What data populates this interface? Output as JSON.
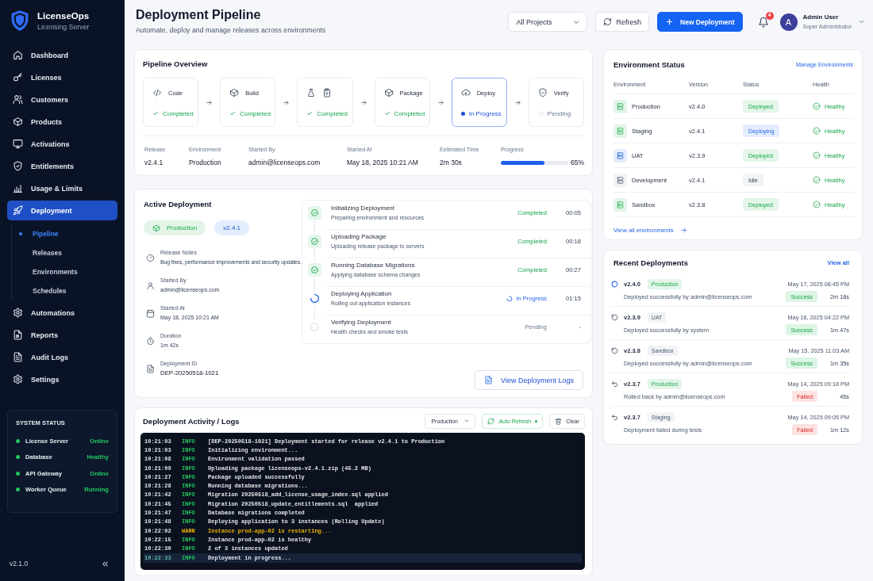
{
  "sidebar": {
    "brand": "LicenseOps",
    "tagline": "Licensing Server",
    "nav": [
      {
        "label": "Dashboard",
        "selected": false
      },
      {
        "label": "Licenses",
        "selected": false
      },
      {
        "label": "Customers",
        "selected": false
      },
      {
        "label": "Products",
        "selected": false
      },
      {
        "label": "Activations",
        "selected": false
      },
      {
        "label": "Entitlements",
        "selected": false
      },
      {
        "label": "Usage & Limits",
        "selected": false
      },
      {
        "label": "Deployment",
        "selected": true,
        "children": [
          {
            "label": "Pipeline",
            "selected": true
          },
          {
            "label": "Releases",
            "selected": false
          },
          {
            "label": "Environments",
            "selected": false
          },
          {
            "label": "Schedules",
            "selected": false
          }
        ]
      },
      {
        "label": "Automations",
        "selected": false
      },
      {
        "label": "Reports",
        "selected": false
      },
      {
        "label": "Audit Logs",
        "selected": false
      },
      {
        "label": "Settings",
        "selected": false
      }
    ],
    "system_status": {
      "title": "SYSTEM STATUS",
      "items": [
        {
          "name": "License Server",
          "status": "Online",
          "color": "#22c55e"
        },
        {
          "name": "Database",
          "status": "Healthy",
          "color": "#22c55e"
        },
        {
          "name": "API Gateway",
          "status": "Online",
          "color": "#22c55e"
        },
        {
          "name": "Worker Queue",
          "status": "Running",
          "color": "#22c55e"
        }
      ]
    },
    "version": "v2.1.0"
  },
  "header": {
    "title": "Deployment Pipeline",
    "subtitle": "Automate, deploy and manage releases across environments",
    "project_filter": "All Projects",
    "refresh_button": "Refresh",
    "new_button": "New Deployment",
    "notification_count": "4",
    "user": {
      "initial": "A",
      "name": "Admin User",
      "role": "Super Administrator"
    }
  },
  "pipeline": {
    "title": "Pipeline Overview",
    "stages": [
      {
        "label": "Code",
        "status": "Completed",
        "kind": "completed"
      },
      {
        "label": "Build",
        "status": "Completed",
        "kind": "completed"
      },
      {
        "status": "Completed",
        "kind": "completed"
      },
      {
        "label": "Package",
        "status": "Completed",
        "kind": "completed"
      },
      {
        "label": "Deploy",
        "status": "In Progress",
        "kind": "running"
      },
      {
        "label": "Verify",
        "status": "Pending",
        "kind": "pending"
      }
    ],
    "details": [
      {
        "label": "Release",
        "value": "v2.4.1"
      },
      {
        "label": "Environment",
        "value": "Production"
      },
      {
        "label": "Started By",
        "value": "admin@licenseops.com"
      },
      {
        "label": "Started At",
        "value": "May 18, 2025 10:21 AM"
      },
      {
        "label": "Estimated Time",
        "value": "2m 30s"
      }
    ],
    "progress": {
      "label": "Progress",
      "level": 0.65,
      "reading": "65%"
    }
  },
  "active_deployment": {
    "title": "Active Deployment",
    "tags": [
      {
        "label": "Production",
        "color": "#e3f5e9"
      },
      {
        "label": "v2.4.1",
        "color": "#e4edfd"
      }
    ],
    "details": [
      {
        "label": "Release Notes",
        "value": "Bug fixes, performance improvements and security updates."
      },
      {
        "label": "Started By",
        "value": "admin@licenseops.com"
      },
      {
        "label": "Started At",
        "value": "May 18, 2025 10:21 AM"
      },
      {
        "label": "Duration",
        "value": "1m 42s"
      },
      {
        "label": "Deployment ID",
        "value": "DEP-20250518-1021"
      }
    ],
    "steps": [
      {
        "title": "Initializing Deployment",
        "description": "Preparing environment and resources",
        "status": "Completed",
        "kind": "completed",
        "time": "00:05"
      },
      {
        "title": "Uploading Package",
        "description": "Uploading release package to servers",
        "status": "Completed",
        "kind": "completed",
        "time": "00:18"
      },
      {
        "title": "Running Database Migrations",
        "description": "Applying database schema changes",
        "status": "Completed",
        "kind": "completed",
        "time": "00:27"
      },
      {
        "title": "Deploying Application",
        "description": "Rolling out application instances",
        "status": "In Progress",
        "kind": "running",
        "time": "01:15"
      },
      {
        "title": "Verifying Deployment",
        "description": "Health checks and smoke tests",
        "status": "Pending",
        "kind": "pending",
        "time": "-"
      }
    ],
    "logs_button": "View Deployment Logs"
  },
  "logs": {
    "title": "Deployment Activity / Logs",
    "environment_filter": "Production",
    "auto_refresh": {
      "label": "Auto Refresh",
      "on": true
    },
    "clear_button": "Clear",
    "lines": [
      {
        "time": "10:21:03",
        "severity": "INFO",
        "kind": "info",
        "message": "[DEP-20250518-1021] Deployment started for release v2.4.1 to Production",
        "selected": false
      },
      {
        "time": "10:21:03",
        "severity": "INFO",
        "kind": "info",
        "message": "Initializing environment...",
        "selected": false
      },
      {
        "time": "10:21:08",
        "severity": "INFO",
        "kind": "info",
        "message": "Environment validation passed",
        "selected": false
      },
      {
        "time": "10:21:09",
        "severity": "INFO",
        "kind": "info",
        "message": "Uploading package licenseops-v2.4.1.zip (45.2 MB)",
        "selected": false
      },
      {
        "time": "10:21:27",
        "severity": "INFO",
        "kind": "info",
        "message": "Package uploaded successfully",
        "selected": false
      },
      {
        "time": "10:21:28",
        "severity": "INFO",
        "kind": "info",
        "message": "Running database migrations...",
        "selected": false
      },
      {
        "time": "10:21:42",
        "severity": "INFO",
        "kind": "info",
        "message": "Migration 20250518_add_license_usage_index.sql applied",
        "selected": false
      },
      {
        "time": "10:21:45",
        "severity": "INFO",
        "kind": "info",
        "message": "Migration 20250518_update_entitlements.sql  applied",
        "selected": false
      },
      {
        "time": "10:21:47",
        "severity": "INFO",
        "kind": "info",
        "message": "Database migrations completed",
        "selected": false
      },
      {
        "time": "10:21:48",
        "severity": "INFO",
        "kind": "info",
        "message": "Deploying application to 3 instances (Rolling Update)",
        "selected": false
      },
      {
        "time": "10:22:02",
        "severity": "WARN",
        "kind": "warn",
        "message": "Instance prod-app-02 is restarting...",
        "selected": false
      },
      {
        "time": "10:22:15",
        "severity": "INFO",
        "kind": "info",
        "message": "Instance prod-app-02 is healthy",
        "selected": false
      },
      {
        "time": "10:22:30",
        "severity": "INFO",
        "kind": "info",
        "message": "2 of 3 instances updated",
        "selected": false
      },
      {
        "time": "10:22:33",
        "severity": "INFO",
        "kind": "info",
        "message": "Deployment in progress...",
        "selected": true
      }
    ]
  },
  "environment_status": {
    "title": "Environment Status",
    "manage_link": "Manage Environments",
    "columns": [
      "Environment",
      "Version",
      "Status",
      "Health"
    ],
    "rows": [
      {
        "name": "Production",
        "version": "v2.4.0",
        "status": "Deployed",
        "kind": "deployed",
        "health": "Healthy",
        "color": "#e3f5e9"
      },
      {
        "name": "Staging",
        "version": "v2.4.1",
        "status": "Deploying",
        "kind": "deploying",
        "health": "Healthy",
        "color": "#e3f5e9"
      },
      {
        "name": "UAT",
        "version": "v2.3.9",
        "status": "Deployed",
        "kind": "deployed",
        "health": "Healthy",
        "color": "#e4edfd"
      },
      {
        "name": "Development",
        "version": "v2.4.1",
        "status": "Idle",
        "kind": "idle",
        "health": "Healthy",
        "color": "#f1f3f6"
      },
      {
        "name": "Sandbox",
        "version": "v2.3.8",
        "status": "Deployed",
        "kind": "deployed",
        "health": "Healthy",
        "color": "#e3f5e9"
      }
    ],
    "view_all_link": "View all environments"
  },
  "recent_deployments": {
    "title": "Recent Deployments",
    "view_all_link": "View all",
    "items": [
      {
        "version": "v2.4.0",
        "tag": {
          "label": "Production",
          "color": "#e3f5e9"
        },
        "date": "May 17, 2025 08:45 PM",
        "description": "Deployed successfully by admin@licenseops.com",
        "result": "Success",
        "kind": "success",
        "duration": "2m 18s",
        "current": true
      },
      {
        "version": "v2.3.9",
        "tag": {
          "label": "UAT",
          "color": "#f1f3f6"
        },
        "date": "May 16, 2025 04:22 PM",
        "description": "Deployed successfully by system",
        "result": "Success",
        "kind": "success",
        "duration": "1m 47s",
        "current": false
      },
      {
        "version": "v2.3.8",
        "tag": {
          "label": "Sandbox",
          "color": "#f1f3f6"
        },
        "date": "May 15, 2025 11:03 AM",
        "description": "Deployed successfully by admin@licenseops.com",
        "result": "Success",
        "kind": "success",
        "duration": "1m 35s",
        "current": false
      },
      {
        "version": "v2.3.7",
        "tag": {
          "label": "Production",
          "color": "#e3f5e9"
        },
        "date": "May 14, 2025 09:18 PM",
        "description": "Rolled back by admin@licenseops.com",
        "result": "Failed",
        "kind": "failed",
        "duration": "45s",
        "current": false
      },
      {
        "version": "v2.3.7",
        "tag": {
          "label": "Staging",
          "color": "#f1f3f6"
        },
        "date": "May 14, 2025 09:05 PM",
        "description": "Deployment failed during tests",
        "result": "Failed",
        "kind": "failed",
        "duration": "1m 12s",
        "current": false
      }
    ]
  }
}
